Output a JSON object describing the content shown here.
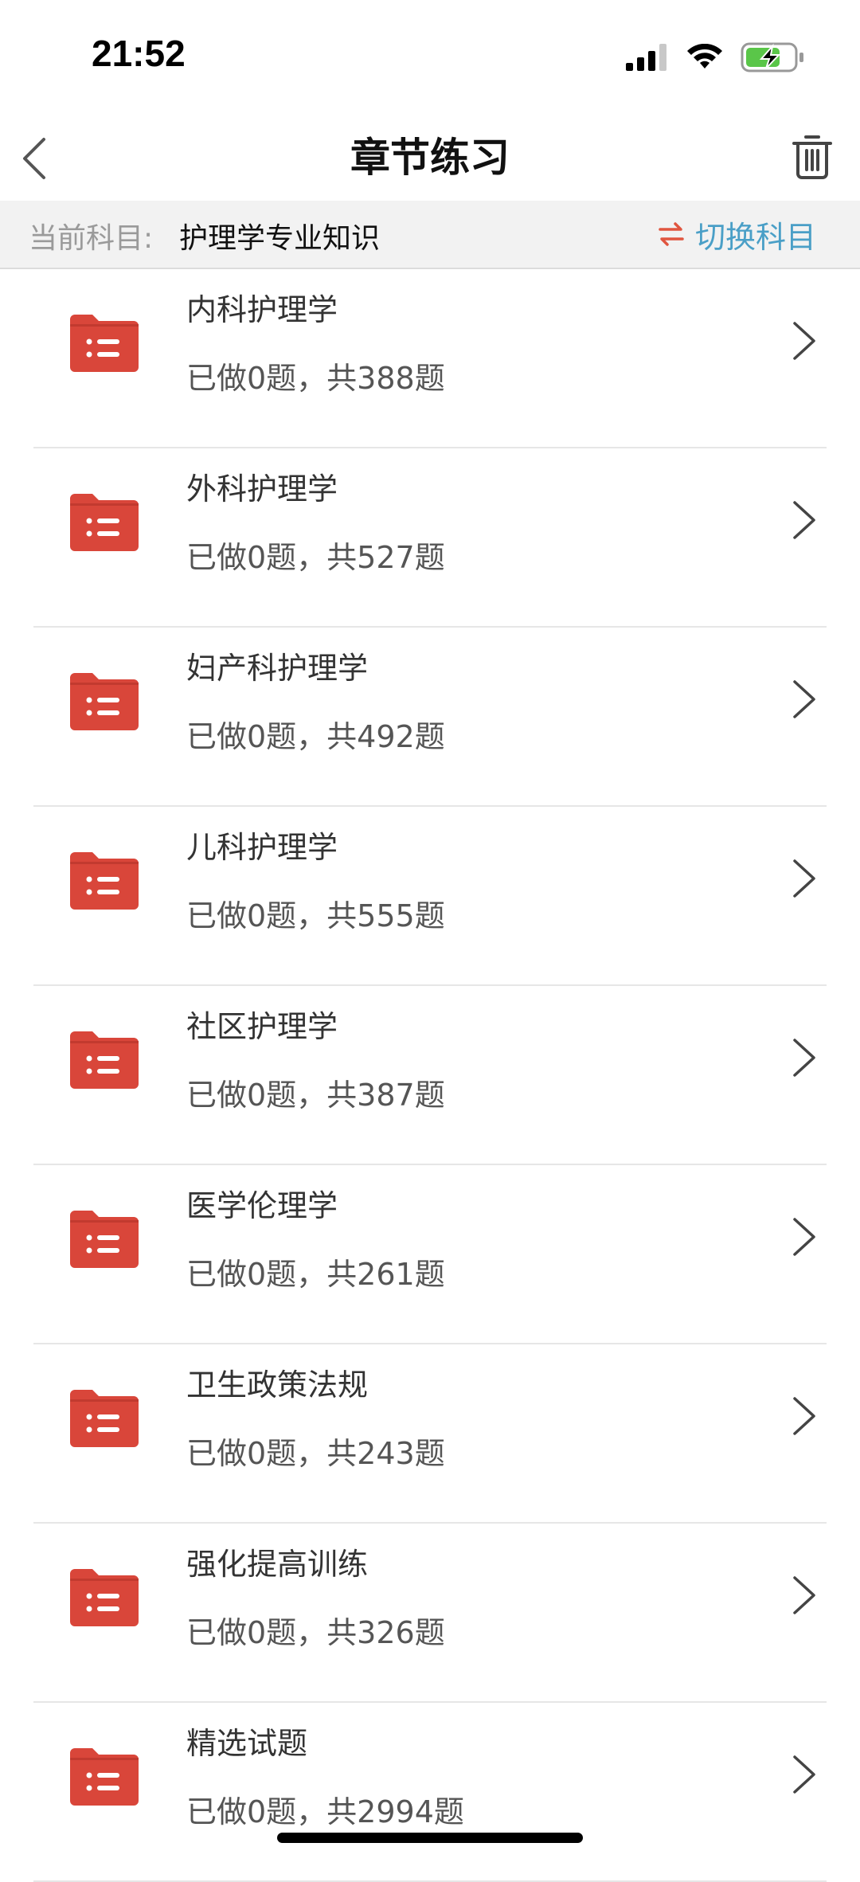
{
  "status_bar": {
    "time": "21:52"
  },
  "nav": {
    "title": "章节练习"
  },
  "subject": {
    "label": "当前科目:",
    "value": "护理学专业知识",
    "switch_label": "切换科目"
  },
  "items": [
    {
      "title": "内科护理学",
      "progress": "已做0题，共388题"
    },
    {
      "title": "外科护理学",
      "progress": "已做0题，共527题"
    },
    {
      "title": "妇产科护理学",
      "progress": "已做0题，共492题"
    },
    {
      "title": "儿科护理学",
      "progress": "已做0题，共555题"
    },
    {
      "title": "社区护理学",
      "progress": "已做0题，共387题"
    },
    {
      "title": "医学伦理学",
      "progress": "已做0题，共261题"
    },
    {
      "title": "卫生政策法规",
      "progress": "已做0题，共243题"
    },
    {
      "title": "强化提高训练",
      "progress": "已做0题，共326题"
    },
    {
      "title": "精选试题",
      "progress": "已做0题，共2994题"
    }
  ],
  "colors": {
    "folder": "#d9463a",
    "switch_arrows": "#e0553f",
    "switch_text": "#4a9fc7",
    "battery": "#5ac649"
  },
  "icons": {
    "back": "chevron-left-icon",
    "trash": "trash-icon",
    "switch": "swap-arrows-icon",
    "folder": "folder-list-icon",
    "chevron": "chevron-right-icon"
  }
}
